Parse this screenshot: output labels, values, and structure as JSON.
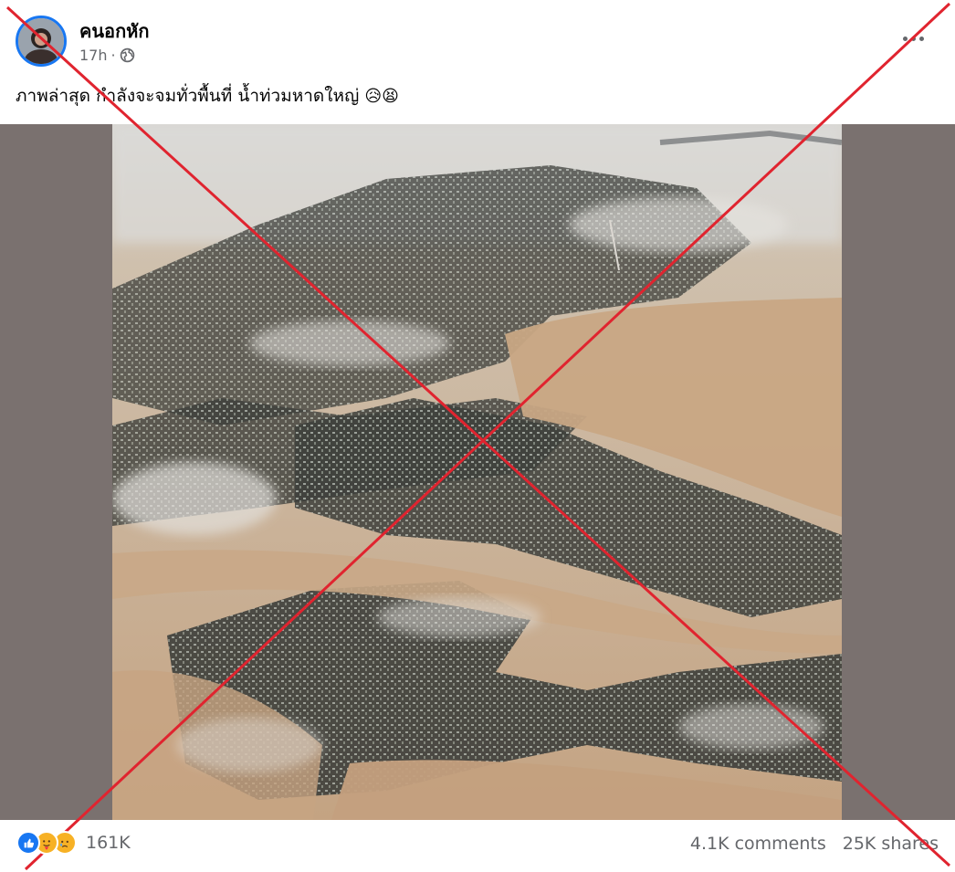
{
  "post": {
    "author": "คนอกหัก",
    "time": "17h",
    "privacy_separator": "·",
    "privacy_icon": "globe-icon",
    "caption": "ภาพล่าสุด กำลังจะจมทั่วพื้นที่ น้ำท่วมหาดใหญ่",
    "caption_emojis": "😥😫",
    "more_icon": "more-horizontal-icon"
  },
  "media": {
    "photo_icon": "aerial-flood-photo",
    "cross_color": "#e0242f"
  },
  "footer": {
    "reaction_icons": [
      "like-icon",
      "care-icon",
      "sad-icon"
    ],
    "reaction_count": "161K",
    "comments": "4.1K comments",
    "shares": "25K shares"
  },
  "colors": {
    "accent": "#1877f2",
    "secondary_text": "#65676b",
    "media_bg": "#7a716f",
    "flood_water": "#c9a887"
  }
}
